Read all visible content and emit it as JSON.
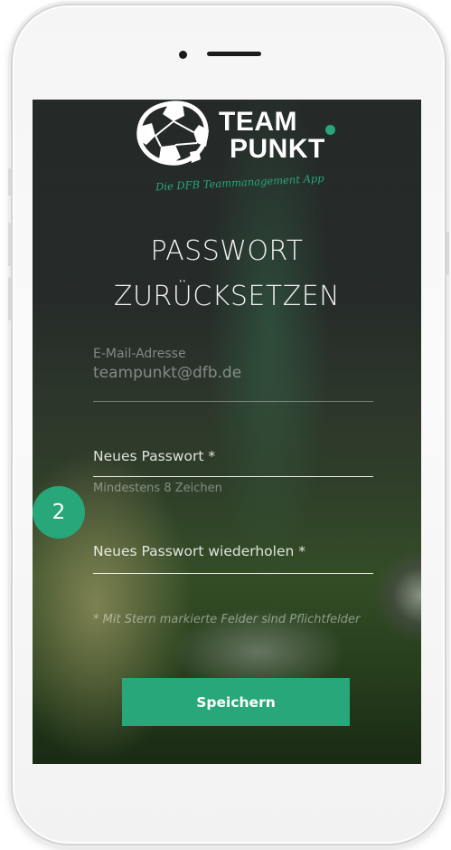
{
  "app": {
    "logo_line1": "TEAM",
    "logo_line2": "PUNKT",
    "tagline": "Die DFB Teammanagement App"
  },
  "page": {
    "title_line1": "PASSWORT",
    "title_line2": "ZURÜCKSETZEN"
  },
  "form": {
    "email_label": "E-Mail-Adresse",
    "email_value": "teampunkt@dfb.de",
    "new_password_placeholder": "Neues Passwort *",
    "new_password_hint": "Mindestens 8 Zeichen",
    "repeat_password_placeholder": "Neues Passwort wiederholen *",
    "required_note": "* Mit Stern markierte Felder sind Pflichtfelder",
    "save_label": "Speichern"
  },
  "step_badge": "2",
  "colors": {
    "accent": "#27a77a",
    "screen_background": "#2b312f",
    "device_frame": "#f5f5f5"
  },
  "icons": {
    "logo": "soccer-ball-icon"
  }
}
